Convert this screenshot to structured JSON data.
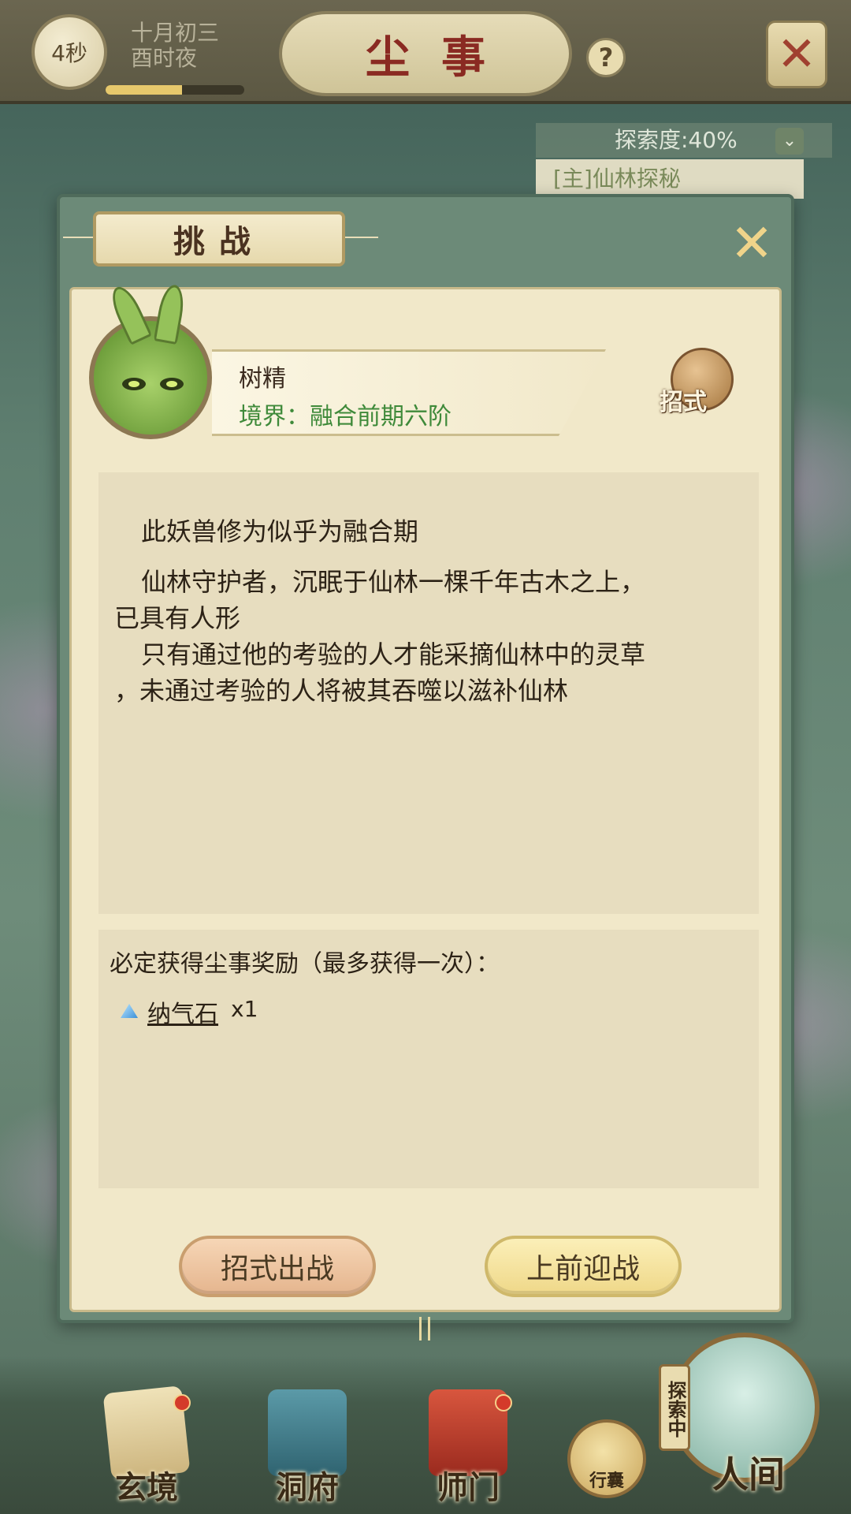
{
  "topbar": {
    "timer": "4秒",
    "date_line1": "十月初三",
    "date_line2": "酉时夜",
    "title": "尘事",
    "help_icon": "?",
    "close_icon": "✕",
    "time_progress": 0.55
  },
  "side": {
    "explore_label": "探索度:40%",
    "quest_label": "[主]仙林探秘"
  },
  "dialog": {
    "title": "挑战",
    "close_icon": "✕",
    "monster": {
      "name": "树精",
      "realm": "境界：融合前期六阶"
    },
    "skills_label": "招式",
    "description": [
      "此妖兽修为似乎为融合期",
      "仙林守护者，沉眠于仙林一棵千年古木之上，",
      "已具有人形",
      "只有通过他的考验的人才能采摘仙林中的灵草",
      "，未通过考验的人将被其吞噬以滋补仙林"
    ],
    "reward": {
      "title": "必定获得尘事奖励（最多获得一次）：",
      "item_name": "纳气石",
      "item_qty": "x1"
    },
    "buttons": {
      "skill_battle": "招式出战",
      "fight": "上前迎战"
    }
  },
  "nav": {
    "items": [
      {
        "label": "玄境",
        "icon": "scroll-icon"
      },
      {
        "label": "洞府",
        "icon": "pavilion-icon"
      },
      {
        "label": "师门",
        "icon": "banner-icon"
      }
    ],
    "bag_label": "行囊",
    "world_label": "人间",
    "exploring_tag": "探索中"
  },
  "colors": {
    "accent_title": "#8a2a22",
    "realm_green": "#3f8a3a",
    "dialog_frame": "#6c8a78",
    "panel_bg": "#f1e8c9"
  }
}
